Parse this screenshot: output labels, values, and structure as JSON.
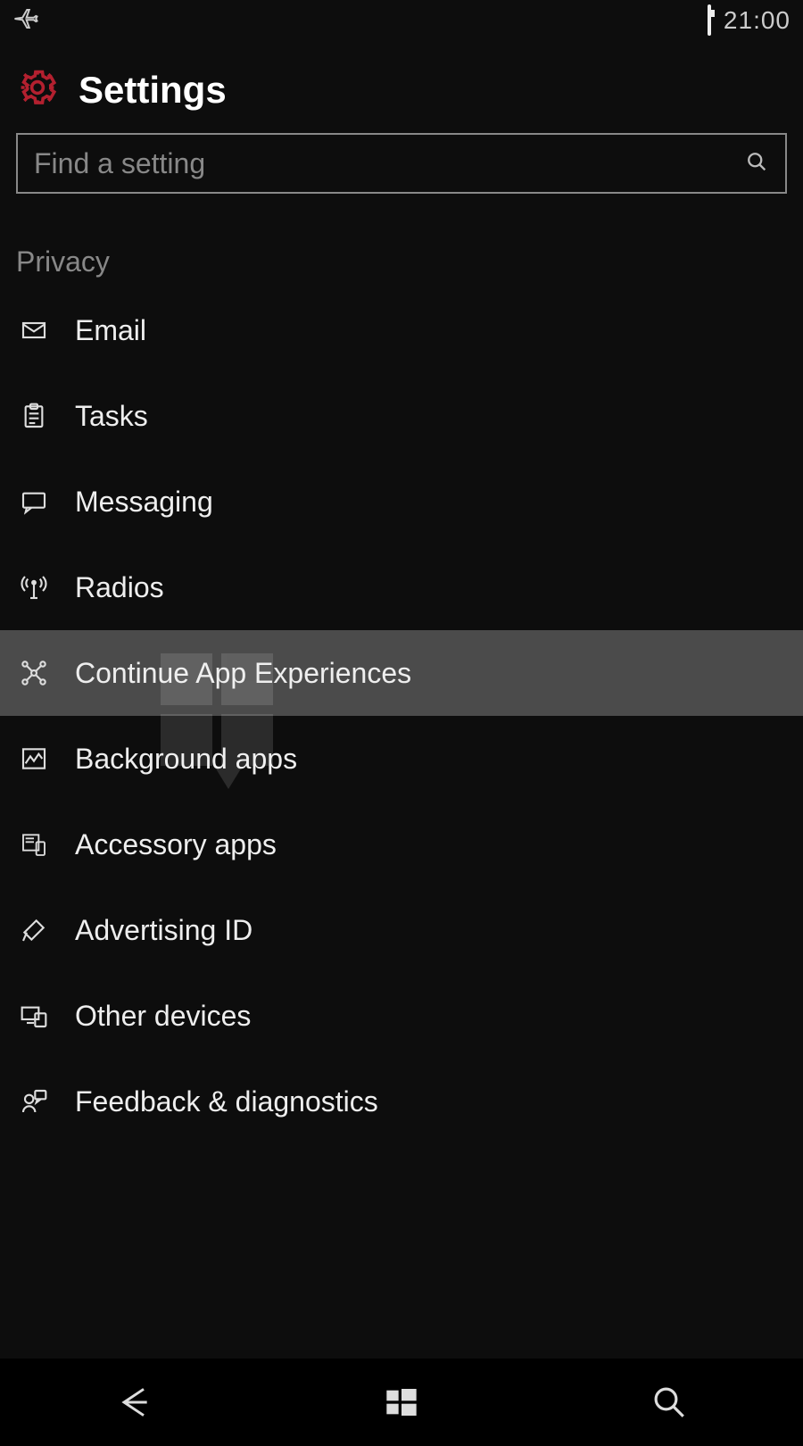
{
  "status": {
    "time": "21:00"
  },
  "header": {
    "title": "Settings"
  },
  "search": {
    "placeholder": "Find a setting"
  },
  "section": {
    "label": "Privacy"
  },
  "items": [
    {
      "icon": "email-icon",
      "label": "Email",
      "selected": false
    },
    {
      "icon": "tasks-icon",
      "label": "Tasks",
      "selected": false
    },
    {
      "icon": "messaging-icon",
      "label": "Messaging",
      "selected": false
    },
    {
      "icon": "radios-icon",
      "label": "Radios",
      "selected": false
    },
    {
      "icon": "continue-app-icon",
      "label": "Continue App Experiences",
      "selected": true
    },
    {
      "icon": "background-apps-icon",
      "label": "Background apps",
      "selected": false
    },
    {
      "icon": "accessory-apps-icon",
      "label": "Accessory apps",
      "selected": false
    },
    {
      "icon": "advertising-id-icon",
      "label": "Advertising ID",
      "selected": false
    },
    {
      "icon": "other-devices-icon",
      "label": "Other devices",
      "selected": false
    },
    {
      "icon": "feedback-icon",
      "label": "Feedback & diagnostics",
      "selected": false
    }
  ],
  "colors": {
    "accent": "#b3202f",
    "bg": "#0d0d0d",
    "highlight": "#4b4b4b"
  }
}
